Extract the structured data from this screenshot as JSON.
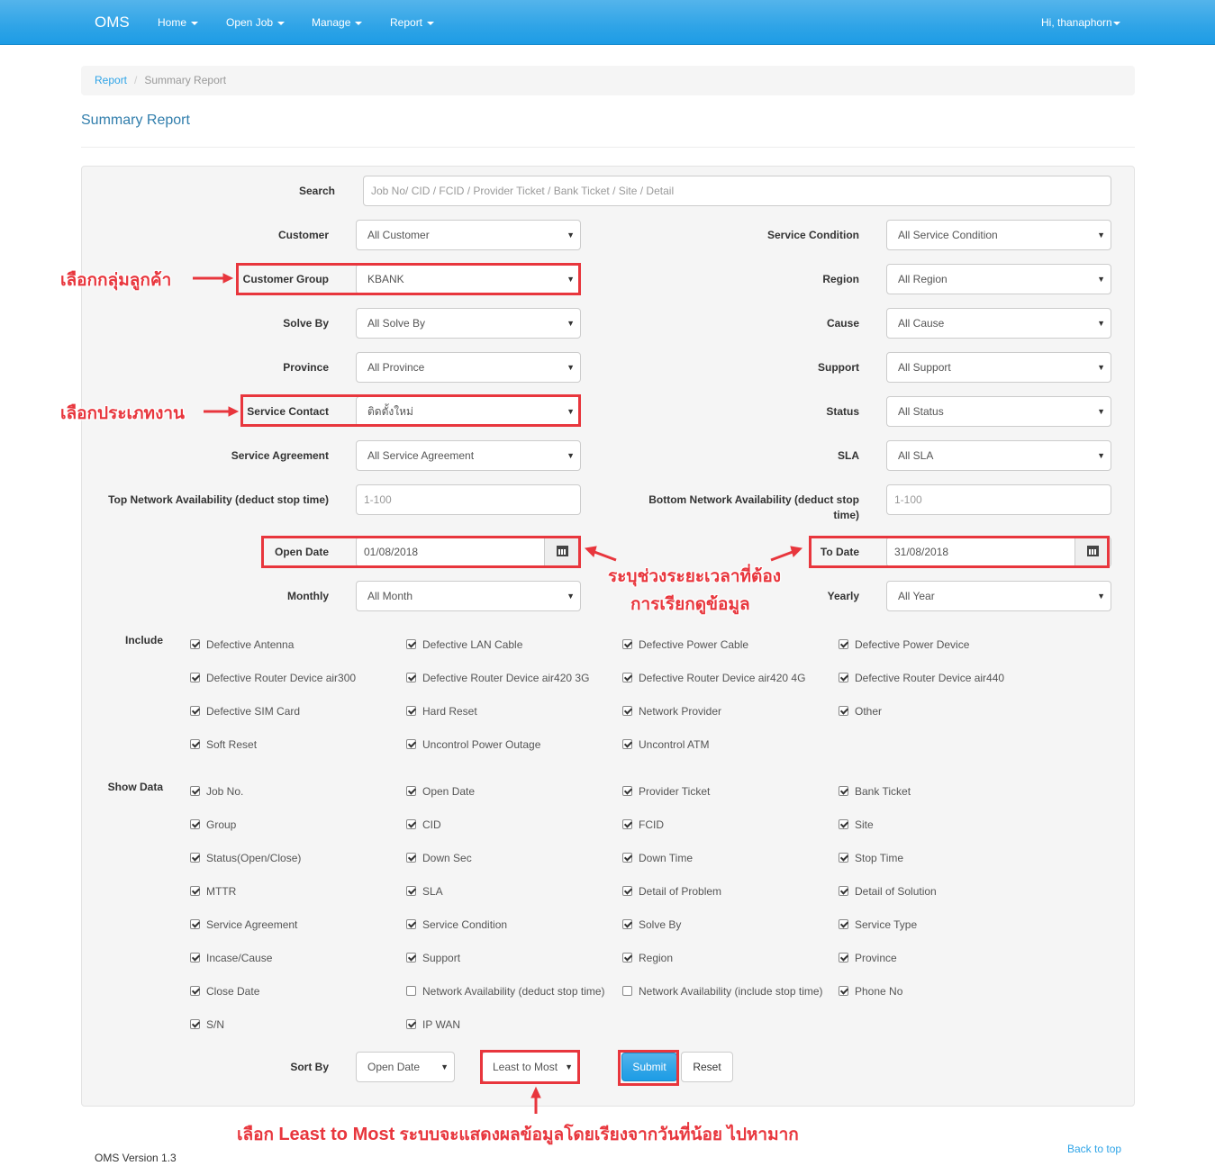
{
  "navbar": {
    "brand": "OMS",
    "menus": [
      "Home",
      "Open Job",
      "Manage",
      "Report"
    ],
    "user": "Hi, thanaphorn"
  },
  "breadcrumb": {
    "parent": "Report",
    "current": "Summary Report"
  },
  "page_title": "Summary Report",
  "form": {
    "search": {
      "label": "Search",
      "placeholder": "Job No/ CID / FCID / Provider Ticket / Bank Ticket / Site / Detail"
    },
    "customer": {
      "label": "Customer",
      "value": "All Customer"
    },
    "service_condition": {
      "label": "Service Condition",
      "value": "All Service Condition"
    },
    "customer_group": {
      "label": "Customer Group",
      "value": "KBANK"
    },
    "region": {
      "label": "Region",
      "value": "All Region"
    },
    "solve_by": {
      "label": "Solve By",
      "value": "All Solve By"
    },
    "cause": {
      "label": "Cause",
      "value": "All Cause"
    },
    "province": {
      "label": "Province",
      "value": "All Province"
    },
    "support": {
      "label": "Support",
      "value": "All Support"
    },
    "service_contact": {
      "label": "Service Contact",
      "value": "ติดตั้งใหม่"
    },
    "status": {
      "label": "Status",
      "value": "All Status"
    },
    "service_agreement": {
      "label": "Service Agreement",
      "value": "All Service Agreement"
    },
    "sla": {
      "label": "SLA",
      "value": "All SLA"
    },
    "top_na": {
      "label": "Top Network Availability (deduct stop time)",
      "placeholder": "1-100"
    },
    "bottom_na": {
      "label_line1": "Bottom Network Availability (deduct stop",
      "label_line2": "time)",
      "placeholder": "1-100"
    },
    "open_date": {
      "label": "Open Date",
      "value": "01/08/2018"
    },
    "to_date": {
      "label": "To Date",
      "value": "31/08/2018"
    },
    "monthly": {
      "label": "Monthly",
      "value": "All Month"
    },
    "yearly": {
      "label": "Yearly",
      "value": "All Year"
    },
    "include": {
      "label": "Include",
      "items": [
        {
          "label": "Defective Antenna",
          "checked": true
        },
        {
          "label": "Defective LAN Cable",
          "checked": true
        },
        {
          "label": "Defective Power Cable",
          "checked": true
        },
        {
          "label": "Defective Power Device",
          "checked": true
        },
        {
          "label": "Defective Router Device air300",
          "checked": true
        },
        {
          "label": "Defective Router Device air420 3G",
          "checked": true
        },
        {
          "label": "Defective Router Device air420 4G",
          "checked": true
        },
        {
          "label": "Defective Router Device air440",
          "checked": true
        },
        {
          "label": "Defective SIM Card",
          "checked": true
        },
        {
          "label": "Hard Reset",
          "checked": true
        },
        {
          "label": "Network Provider",
          "checked": true
        },
        {
          "label": "Other",
          "checked": true
        },
        {
          "label": "Soft Reset",
          "checked": true
        },
        {
          "label": "Uncontrol Power Outage",
          "checked": true
        },
        {
          "label": "Uncontrol ATM",
          "checked": true
        }
      ]
    },
    "show_data": {
      "label": "Show Data",
      "items": [
        {
          "label": "Job No.",
          "checked": true
        },
        {
          "label": "Open Date",
          "checked": true
        },
        {
          "label": "Provider Ticket",
          "checked": true
        },
        {
          "label": "Bank Ticket",
          "checked": true
        },
        {
          "label": "Group",
          "checked": true
        },
        {
          "label": "CID",
          "checked": true
        },
        {
          "label": "FCID",
          "checked": true
        },
        {
          "label": "Site",
          "checked": true
        },
        {
          "label": "Status(Open/Close)",
          "checked": true
        },
        {
          "label": "Down Sec",
          "checked": true
        },
        {
          "label": "Down Time",
          "checked": true
        },
        {
          "label": "Stop Time",
          "checked": true
        },
        {
          "label": "MTTR",
          "checked": true
        },
        {
          "label": "SLA",
          "checked": true
        },
        {
          "label": "Detail of Problem",
          "checked": true
        },
        {
          "label": "Detail of Solution",
          "checked": true
        },
        {
          "label": "Service Agreement",
          "checked": true
        },
        {
          "label": "Service Condition",
          "checked": true
        },
        {
          "label": "Solve By",
          "checked": true
        },
        {
          "label": "Service Type",
          "checked": true
        },
        {
          "label": "Incase/Cause",
          "checked": true
        },
        {
          "label": "Support",
          "checked": true
        },
        {
          "label": "Region",
          "checked": true
        },
        {
          "label": "Province",
          "checked": true
        },
        {
          "label": "Close Date",
          "checked": true
        },
        {
          "label": "Network Availability (deduct stop time)",
          "checked": false
        },
        {
          "label": "Network Availability (include stop time)",
          "checked": false
        },
        {
          "label": "Phone No",
          "checked": true
        },
        {
          "label": "S/N",
          "checked": true
        },
        {
          "label": "IP WAN",
          "checked": true
        }
      ]
    },
    "sort_by": {
      "label": "Sort By",
      "field": "Open Date",
      "order": "Least to Most"
    },
    "submit_label": "Submit",
    "reset_label": "Reset"
  },
  "annotations": {
    "customer_group": "เลือกกลุ่มลูกค้า",
    "service_type": "เลือกประเภทงาน",
    "date_line1": "ระบุช่วงระยะเวลาที่ต้อง",
    "date_line2": "การเรียกดูข้อมูล",
    "sort_a": "เลือก",
    "sort_b": "Least to Most",
    "sort_c": "ระบบจะแสดงผลข้อมูลโดยเรียงจากวันที่น้อย ไปหามาก"
  },
  "footer": {
    "version": "OMS Version 1.3",
    "back_to_top": "Back to top"
  },
  "colors": {
    "navbar": "#2fa4e7",
    "annotation": "#e8363d",
    "link": "#2fa4e7"
  }
}
